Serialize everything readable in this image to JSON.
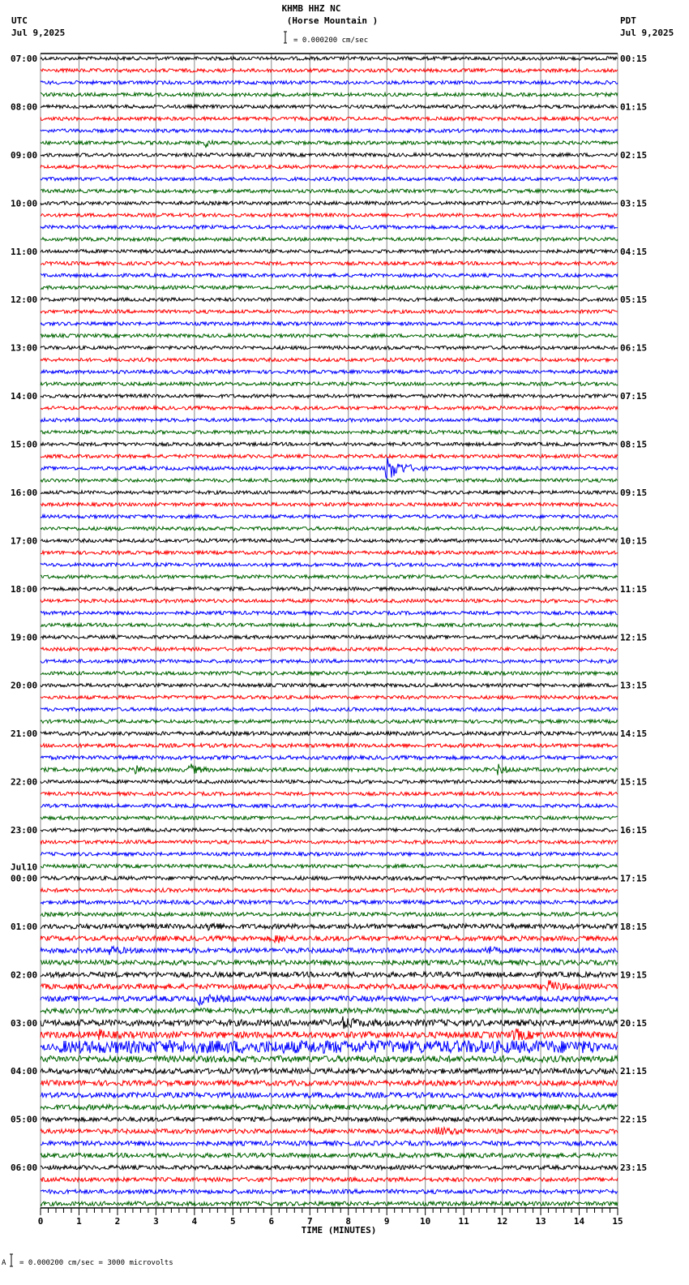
{
  "header": {
    "station": "KHMB HHZ NC",
    "location": "(Horse Mountain )",
    "scale": "= 0.000200 cm/sec",
    "left_tz": "UTC",
    "left_date": "Jul 9,2025",
    "right_tz": "PDT",
    "right_date": "Jul 9,2025"
  },
  "footer": {
    "mark": "A",
    "scale": "= 0.000200 cm/sec =    3000 microvolts"
  },
  "chart_data": {
    "type": "line",
    "title": "KHMB HHZ NC (Horse Mountain )",
    "xlabel": "TIME (MINUTES)",
    "xlim": [
      0,
      15
    ],
    "x_ticks": [
      "0",
      "1",
      "2",
      "3",
      "4",
      "5",
      "6",
      "7",
      "8",
      "9",
      "10",
      "11",
      "12",
      "13",
      "14",
      "15"
    ],
    "traces_per_hour": 4,
    "trace_colors": [
      "#000000",
      "#ff0000",
      "#0000ff",
      "#006400"
    ],
    "left_labels": [
      "07:00",
      "08:00",
      "09:00",
      "10:00",
      "11:00",
      "12:00",
      "13:00",
      "14:00",
      "15:00",
      "16:00",
      "17:00",
      "18:00",
      "19:00",
      "20:00",
      "21:00",
      "22:00",
      "23:00",
      "00:00",
      "01:00",
      "02:00",
      "03:00",
      "04:00",
      "05:00",
      "06:00"
    ],
    "date_change_label": "Jul10",
    "right_labels": [
      "00:15",
      "01:15",
      "02:15",
      "03:15",
      "04:15",
      "05:15",
      "06:15",
      "07:15",
      "08:15",
      "09:15",
      "10:15",
      "11:15",
      "12:15",
      "13:15",
      "14:15",
      "15:15",
      "16:15",
      "17:15",
      "18:15",
      "19:15",
      "20:15",
      "21:15",
      "22:15",
      "23:15"
    ],
    "hourly_noise_level": [
      1,
      1,
      1,
      1,
      1,
      1,
      1,
      1,
      1,
      1,
      1,
      1,
      1,
      1,
      1.1,
      1,
      1,
      1.1,
      1.4,
      1.5,
      1.8,
      1.5,
      1.3,
      1.2
    ],
    "events": [
      {
        "trace": 34,
        "minute": 9.0,
        "duration": 1.0,
        "amplitude": 6
      },
      {
        "trace": 7,
        "minute": 4.3,
        "duration": 0.3,
        "amplitude": 2
      },
      {
        "trace": 59,
        "minute": 2.5,
        "duration": 0.4,
        "amplitude": 1.8
      },
      {
        "trace": 59,
        "minute": 3.9,
        "duration": 0.6,
        "amplitude": 2.2
      },
      {
        "trace": 59,
        "minute": 11.9,
        "duration": 0.6,
        "amplitude": 2
      },
      {
        "trace": 72,
        "minute": 4.4,
        "duration": 0.6,
        "amplitude": 1.8
      },
      {
        "trace": 73,
        "minute": 6.1,
        "duration": 0.6,
        "amplitude": 1.8
      },
      {
        "trace": 74,
        "minute": 1.8,
        "duration": 0.6,
        "amplitude": 2
      },
      {
        "trace": 74,
        "minute": 11.6,
        "duration": 0.5,
        "amplitude": 1.7
      },
      {
        "trace": 77,
        "minute": 13.2,
        "duration": 0.8,
        "amplitude": 2.2
      },
      {
        "trace": 78,
        "minute": 4.1,
        "duration": 1.0,
        "amplitude": 2.2
      },
      {
        "trace": 80,
        "minute": 7.9,
        "duration": 1.0,
        "amplitude": 1.8
      },
      {
        "trace": 81,
        "minute": 1.5,
        "duration": 0.6,
        "amplitude": 1.8
      },
      {
        "trace": 81,
        "minute": 12.3,
        "duration": 1.0,
        "amplitude": 2
      },
      {
        "trace": 82,
        "minute": 0.5,
        "duration": 14,
        "amplitude": 1.6
      },
      {
        "trace": 89,
        "minute": 10.3,
        "duration": 1.2,
        "amplitude": 1.6
      }
    ]
  }
}
